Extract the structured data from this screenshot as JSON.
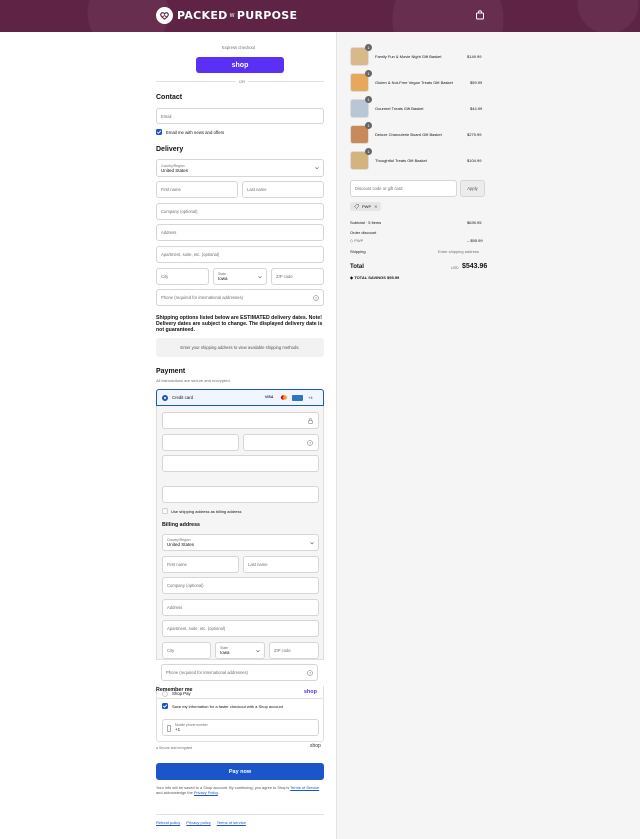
{
  "header": {
    "brand_name": "PACKED",
    "brand_connector": "W",
    "brand_name2": "PURPOSE"
  },
  "express": {
    "label": "Express checkout",
    "shop_button": "shop",
    "or": "OR"
  },
  "contact": {
    "title": "Contact",
    "email_placeholder": "Email",
    "news_label": "Email me with news and offers"
  },
  "delivery": {
    "title": "Delivery",
    "country_label": "Country/Region",
    "country_value": "United States",
    "first_name": "First name",
    "last_name": "Last name",
    "company": "Company (optional)",
    "address": "Address",
    "apartment": "Apartment, suite, etc. (optional)",
    "city": "City",
    "state_label": "State",
    "state_value": "Iowa",
    "zip": "ZIP code",
    "phone": "Phone (required for international addresses)",
    "shipping_notice": "Shipping options listed below are ESTIMATED delivery dates. Note! Delivery dates are subject to change. The displayed delivery date is not guaranteed.",
    "shipping_methods_msg": "Enter your shipping address to view available shipping methods."
  },
  "payment": {
    "title": "Payment",
    "subtitle": "All transactions are secure and encrypted.",
    "credit_card": "Credit card",
    "card_more": "+4",
    "use_shipping": "Use shipping address as billing address",
    "billing_title": "Billing address",
    "shop_pay": "Shop Pay",
    "shop_pay_sub": "Pay in full or in installments",
    "shop_pay_logo": "shop"
  },
  "billing": {
    "country_label": "Country/Region",
    "country_value": "United States",
    "first_name": "First name",
    "last_name": "Last name",
    "company": "Company (optional)",
    "address": "Address",
    "apartment": "Apartment, suite, etc. (optional)",
    "city": "City",
    "state_label": "State",
    "state_value": "Iowa",
    "zip": "ZIP code",
    "phone": "Phone (required for international addresses)"
  },
  "remember": {
    "title": "Remember me",
    "save_label": "Save my information for a faster checkout with a Shop account",
    "mobile_label": "Mobile phone number",
    "mobile_value": "+1",
    "secure": "Secure and encrypted",
    "shop_logo": "shop"
  },
  "pay_now": "Pay now",
  "legal": {
    "line1": "Your info will be saved to a Shop account. By continuing, you agree to Shop's",
    "terms": "Terms of Service",
    "and": "and acknowledge the",
    "privacy": "Privacy Policy",
    "end": "."
  },
  "footer_links": [
    "Refund policy",
    "Privacy policy",
    "Terms of service"
  ],
  "order": {
    "items": [
      {
        "qty": "1",
        "name": "Family Fun & Movie Night Gift Basket",
        "price": "$149.99"
      },
      {
        "qty": "1",
        "name": "Gluten & Nut-Free Vegan Treats Gift Basket",
        "price": "$59.99"
      },
      {
        "qty": "1",
        "name": "Gourmet Treats Gift Basket",
        "price": "$44.99"
      },
      {
        "qty": "1",
        "name": "Deluxe Charcuterie Board Gift Basket",
        "price": "$279.99"
      },
      {
        "qty": "1",
        "name": "Thoughtful Treats Gift Basket",
        "price": "$104.99"
      }
    ],
    "discount_placeholder": "Discount code or gift card",
    "apply": "Apply",
    "code_tag": "PWP",
    "subtotal_label": "Subtotal · 5 items",
    "subtotal_value": "$639.95",
    "order_discount_label": "Order discount",
    "discount_code": "PWP",
    "discount_value": "– $95.99",
    "shipping_label": "Shipping",
    "shipping_value": "Enter shipping address",
    "total_label": "Total",
    "currency": "USD",
    "total_value": "$543.96",
    "savings_label": "TOTAL SAVINGS",
    "savings_value": "$95.99"
  },
  "colors": {
    "brand": "#5f2346",
    "shop_purple": "#5a31f4",
    "primary_blue": "#1a55c9"
  }
}
